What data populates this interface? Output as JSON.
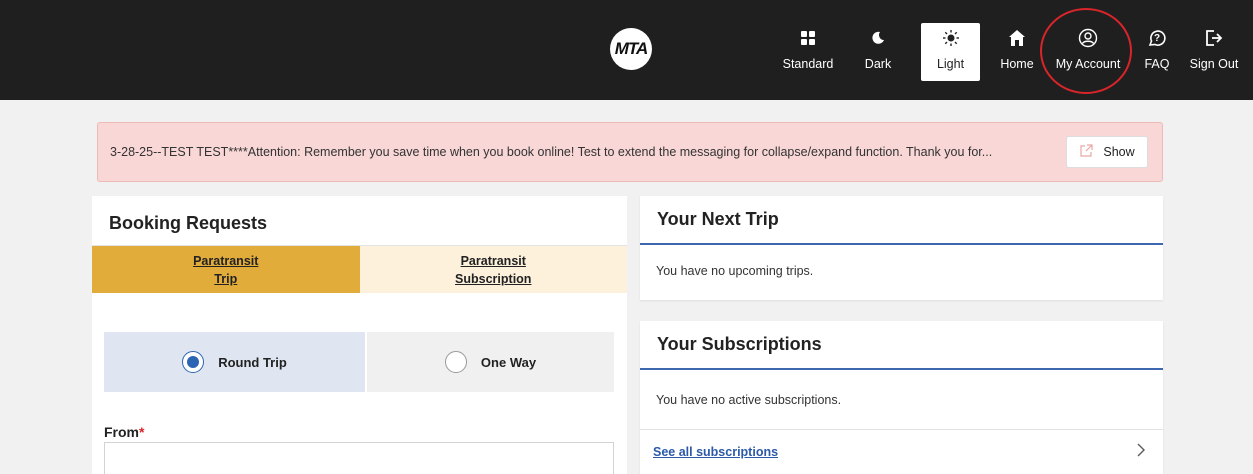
{
  "header": {
    "logo_text": "MTA",
    "nav": [
      {
        "label": "Standard",
        "icon": "grid-icon"
      },
      {
        "label": "Dark",
        "icon": "moon-icon"
      },
      {
        "label": "Light",
        "icon": "sun-icon",
        "active": true
      },
      {
        "label": "Home",
        "icon": "home-icon"
      },
      {
        "label": "My Account",
        "icon": "account-icon"
      },
      {
        "label": "FAQ",
        "icon": "help-icon"
      },
      {
        "label": "Sign Out",
        "icon": "sign-out-icon"
      }
    ]
  },
  "alert": {
    "text": "3-28-25--TEST TEST****Attention: Remember you save time when you book online! Test to extend the messaging for collapse/expand function. Thank you for...",
    "show_label": "Show"
  },
  "booking": {
    "title": "Booking Requests",
    "tabs": [
      {
        "line1": "Paratransit",
        "line2": "Trip",
        "selected": true
      },
      {
        "line1": "Paratransit",
        "line2": "Subscription",
        "selected": false
      }
    ],
    "trip_types": {
      "round_trip": "Round Trip",
      "one_way": "One Way",
      "selected": "round_trip"
    },
    "from_label": "From",
    "required_mark": "*",
    "from_value": ""
  },
  "next_trip": {
    "title": "Your Next Trip",
    "message": "You have no upcoming trips."
  },
  "subscriptions": {
    "title": "Your Subscriptions",
    "message": "You have no active subscriptions.",
    "link": "See all subscriptions"
  },
  "colors": {
    "topbar": "#1f1f1f",
    "accent_blue": "#2c64b4",
    "tab_selected": "#e2ac3a",
    "tab_unselected": "#fdf1dc",
    "alert_bg": "#f8d7d6",
    "highlight": "#d9252a"
  }
}
